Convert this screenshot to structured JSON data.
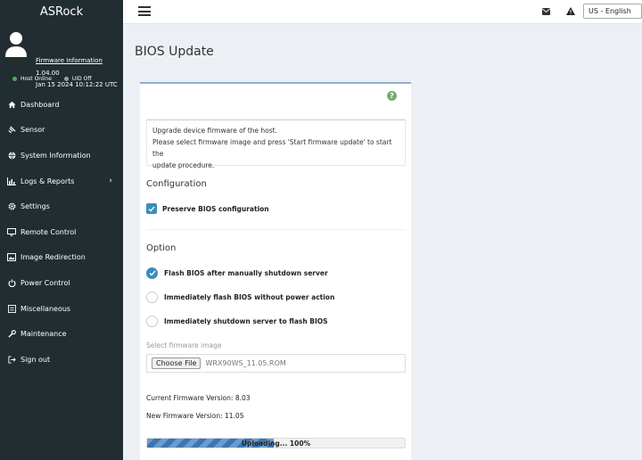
{
  "brand": "ASRock",
  "user_panel": {
    "firmware_link": "Firmware Information",
    "firmware_version": "1.04.00",
    "firmware_date": "Jan 15 2024 10:12:22 UTC",
    "host_status": "Host Online",
    "uid_status": "UID Off",
    "host_color": "#4caf50",
    "uid_color": "#9e9e9e"
  },
  "sidebar": {
    "items": [
      {
        "label": "Dashboard",
        "icon": "home-icon"
      },
      {
        "label": "Sensor",
        "icon": "sensor-icon"
      },
      {
        "label": "System Information",
        "icon": "globe-icon"
      },
      {
        "label": "Logs & Reports",
        "icon": "bar-chart-icon"
      },
      {
        "label": "Settings",
        "icon": "gear-icon"
      },
      {
        "label": "Remote Control",
        "icon": "monitor-icon"
      },
      {
        "label": "Image Redirection",
        "icon": "image-icon"
      },
      {
        "label": "Power Control",
        "icon": "power-icon"
      },
      {
        "label": "Miscellaneous",
        "icon": "list-icon"
      },
      {
        "label": "Maintenance",
        "icon": "wrench-icon"
      },
      {
        "label": "Sign out",
        "icon": "signout-icon"
      }
    ]
  },
  "topbar": {
    "language": "US - English"
  },
  "page": {
    "title": "BIOS Update",
    "help": "?",
    "description_line1": "Upgrade device firmware of the host.",
    "description_line2": "Please select firmware image and press 'Start firmware update' to start the",
    "description_line3": "update procedure.",
    "configuration_heading": "Configuration",
    "preserve_label": "Preserve BIOS configuration",
    "preserve_checked": true,
    "option_heading": "Option",
    "options": [
      {
        "label": "Flash BIOS after manually shutdown server",
        "checked": true
      },
      {
        "label": "Immediately flash BIOS without power action",
        "checked": false
      },
      {
        "label": "Immediately shutdown server to flash BIOS",
        "checked": false
      }
    ],
    "file_label": "Select firmware image",
    "file_button": "Choose File",
    "file_name": "WRX90WS_11.05.ROM",
    "current_fw_label": "Current Firmware Version:",
    "current_fw_value": "8.03",
    "new_fw_label": "New Firmware Version:",
    "new_fw_value": "11.05",
    "progress_text": "Uploading... 100%",
    "progress_fraction": 0.49
  }
}
